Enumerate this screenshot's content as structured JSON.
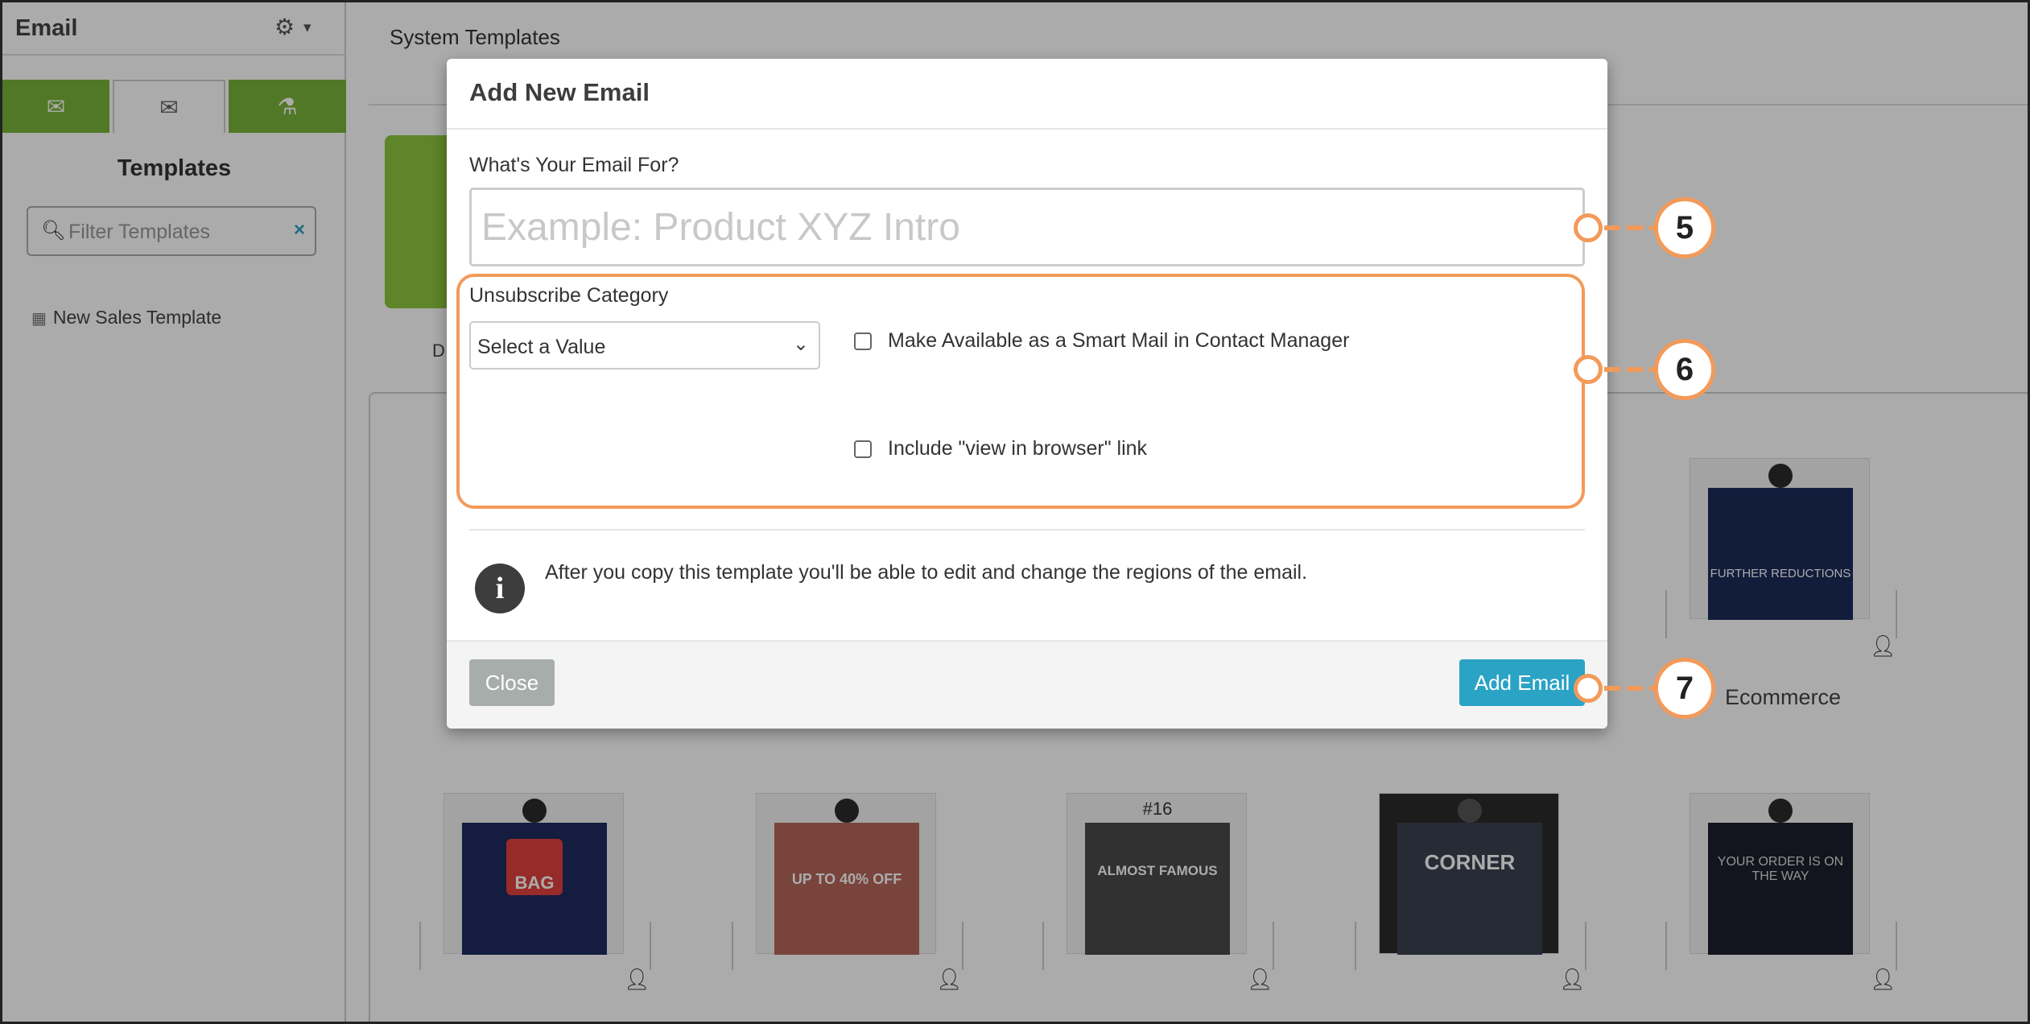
{
  "sidebar": {
    "title": "Email",
    "templates_heading": "Templates",
    "filter_placeholder": "Filter Templates",
    "items": [
      {
        "label": "New Sales Template"
      }
    ]
  },
  "main": {
    "title": "System Templates",
    "folder_label_partial": "D",
    "card_labels": {
      "ecommerce": "Ecommerce"
    },
    "card_texts": {
      "further_reductions": "FURTHER REDUCTIONS",
      "bag": "BAG",
      "sale": "UP TO 40% OFF",
      "heading16": "#16",
      "almost_famous": "ALMOST FAMOUS",
      "corner": "CORNER",
      "order": "YOUR ORDER IS ON THE WAY"
    }
  },
  "modal": {
    "title": "Add New Email",
    "email_for_label": "What's Your Email For?",
    "email_for_placeholder": "Example: Product XYZ Intro",
    "unsubscribe_label": "Unsubscribe Category",
    "select_value": "Select a Value",
    "smart_mail_label": "Make Available as a Smart Mail in Contact Manager",
    "view_in_browser_label": "Include \"view in browser\" link",
    "info_text": "After you copy this template you'll be able to edit and change the regions of the email.",
    "close_label": "Close",
    "add_label": "Add Email"
  },
  "callouts": [
    "5",
    "6",
    "7"
  ],
  "colors": {
    "accent_green": "#7ab339",
    "accent_blue": "#2aa3c4",
    "callout_orange": "#f39a5a"
  },
  "icons": [
    "gear-icon",
    "envelope-icon",
    "envelope-outline-icon",
    "flask-icon",
    "search-icon",
    "clear-icon",
    "table-icon",
    "chevron-down-icon",
    "info-icon",
    "person-icon"
  ]
}
